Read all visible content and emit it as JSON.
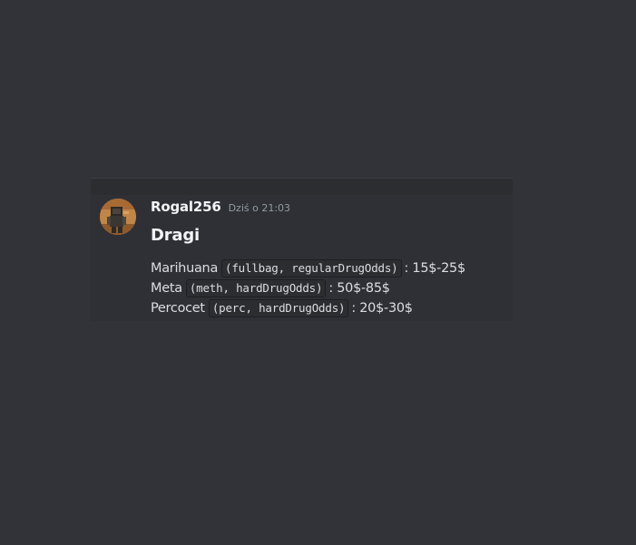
{
  "message": {
    "author": "Rogal256",
    "timestamp": "Dziś o 21:03",
    "heading": "Dragi",
    "items": [
      {
        "name": "Marihuana",
        "code": "(fullbag, regularDrugOdds)",
        "price": ": 15$-25$"
      },
      {
        "name": "Meta",
        "code": "(meth, hardDrugOdds)",
        "price": ": 50$-85$"
      },
      {
        "name": "Percocet",
        "code": "(perc, hardDrugOdds)",
        "price": ": 20$-30$"
      }
    ]
  },
  "colors": {
    "background": "#313338",
    "message_hover": "#2e3035",
    "text_primary": "#f2f3f5",
    "text_body": "#dbdee1",
    "text_muted": "#949ba4",
    "code_bg": "#2b2d31"
  }
}
